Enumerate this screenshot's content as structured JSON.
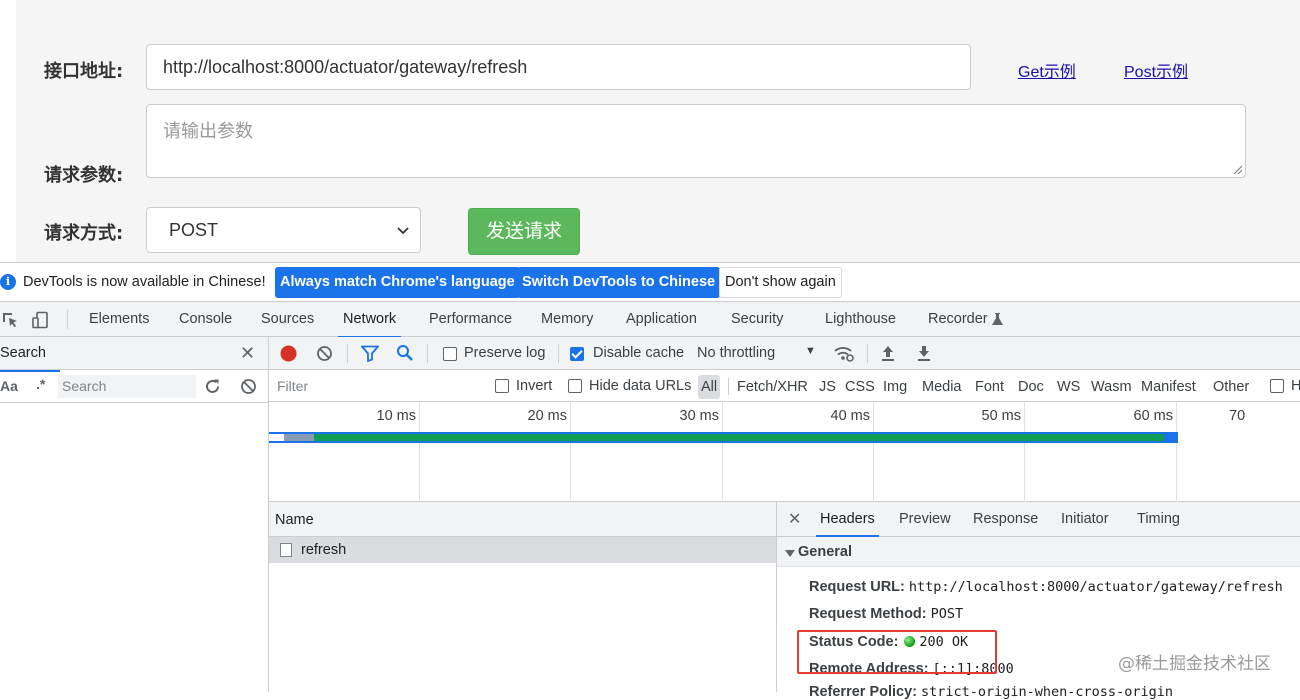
{
  "form": {
    "url_label": "接口地址:",
    "url_value": "http://localhost:8000/actuator/gateway/refresh",
    "get_example": "Get示例",
    "post_example": "Post示例",
    "params_label": "请求参数:",
    "params_placeholder": "请输出参数",
    "method_label": "请求方式:",
    "method_value": "POST",
    "send_button": "发送请求"
  },
  "infobar": {
    "text": "DevTools is now available in Chinese!",
    "btn_match": "Always match Chrome's language",
    "btn_switch": "Switch DevTools to Chinese",
    "btn_dismiss": "Don't show again"
  },
  "tabs": [
    "Elements",
    "Console",
    "Sources",
    "Network",
    "Performance",
    "Memory",
    "Application",
    "Security",
    "Lighthouse",
    "Recorder"
  ],
  "active_tab": "Network",
  "search_panel": {
    "title": "Search",
    "aa": "Aa",
    "regex": ".*",
    "placeholder": "Search"
  },
  "network_toolbar": {
    "preserve_log": "Preserve log",
    "disable_cache": "Disable cache",
    "throttling": "No throttling"
  },
  "filter_bar": {
    "placeholder": "Filter",
    "invert": "Invert",
    "hide_data_urls": "Hide data URLs",
    "types": [
      "All",
      "Fetch/XHR",
      "JS",
      "CSS",
      "Img",
      "Media",
      "Font",
      "Doc",
      "WS",
      "Wasm",
      "Manifest",
      "Other"
    ],
    "trailing": "H"
  },
  "timeline": {
    "ticks": [
      "10 ms",
      "20 ms",
      "30 ms",
      "40 ms",
      "50 ms",
      "60 ms",
      "70"
    ]
  },
  "requests": {
    "column": "Name",
    "rows": [
      "refresh"
    ]
  },
  "details": {
    "tabs": [
      "Headers",
      "Preview",
      "Response",
      "Initiator",
      "Timing"
    ],
    "general": "General",
    "request_url_k": "Request URL:",
    "request_url_v": "http://localhost:8000/actuator/gateway/refresh",
    "request_method_k": "Request Method:",
    "request_method_v": "POST",
    "status_code_k": "Status Code:",
    "status_code_v": "200 OK",
    "remote_address_k": "Remote Address:",
    "remote_address_v": "[::1]:8000",
    "referrer_policy_k": "Referrer Policy:",
    "referrer_policy_v": "strict-origin-when-cross-origin"
  },
  "watermark": "@稀土掘金技术社区",
  "colors": {
    "accent": "#1a73e8",
    "send_button": "#5cb85c",
    "status_ok": "#0b9e0b",
    "highlight_box": "#e53935"
  }
}
